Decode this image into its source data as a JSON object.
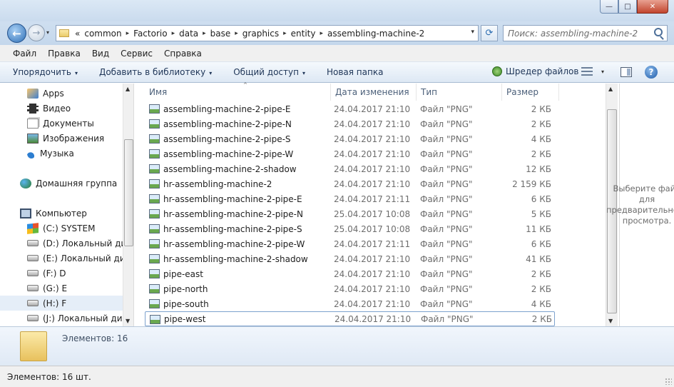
{
  "window": {
    "buttons": {
      "minimize": "—",
      "maximize": "□",
      "close": "✕"
    }
  },
  "navigation": {
    "back_glyph": "←",
    "forward_glyph": "→",
    "dropdown_glyph": "▾"
  },
  "address": {
    "overflow": "«",
    "crumbs": [
      "common",
      "Factorio",
      "data",
      "base",
      "graphics",
      "entity",
      "assembling-machine-2"
    ],
    "separator": "▸",
    "dropdown_glyph": "▾",
    "refresh_glyph": "⟳"
  },
  "search": {
    "placeholder": "Поиск: assembling-machine-2"
  },
  "menubar": [
    "Файл",
    "Правка",
    "Вид",
    "Сервис",
    "Справка"
  ],
  "commandbar": {
    "organize": "Упорядочить",
    "library": "Добавить в библиотеку",
    "share": "Общий доступ",
    "new_folder": "Новая папка",
    "shredder": "Шредер файлов",
    "help": "?",
    "arrow": "▾"
  },
  "nav": {
    "items": [
      {
        "label": "Apps",
        "icon": "apps-icon"
      },
      {
        "label": "Видео",
        "icon": "video-icon"
      },
      {
        "label": "Документы",
        "icon": "documents-icon"
      },
      {
        "label": "Изображения",
        "icon": "images-icon"
      },
      {
        "label": "Музыка",
        "icon": "music-icon"
      },
      {
        "label": "Домашняя группа",
        "icon": "homegroup-icon"
      },
      {
        "label": "Компьютер",
        "icon": "computer-icon"
      },
      {
        "label": "(C:) SYSTEM",
        "icon": "system-drive-icon"
      },
      {
        "label": "(D:) Локальный диск",
        "icon": "drive-icon"
      },
      {
        "label": "(E:) Локальный диск",
        "icon": "drive-icon"
      },
      {
        "label": "(F:) D",
        "icon": "drive-icon"
      },
      {
        "label": "(G:) E",
        "icon": "drive-icon"
      },
      {
        "label": "(H:) F",
        "icon": "drive-icon",
        "selected": true
      },
      {
        "label": "(J:) Локальный диск",
        "icon": "drive-icon"
      }
    ],
    "scroll_up": "▲",
    "scroll_down": "▼"
  },
  "columns": {
    "name": "Имя",
    "date": "Дата изменения",
    "type": "Тип",
    "size": "Размер",
    "sort_glyph": "^"
  },
  "files": [
    {
      "name": "assembling-machine-2-pipe-E",
      "date": "24.04.2017 21:10",
      "type": "Файл \"PNG\"",
      "size": "2 КБ"
    },
    {
      "name": "assembling-machine-2-pipe-N",
      "date": "24.04.2017 21:10",
      "type": "Файл \"PNG\"",
      "size": "2 КБ"
    },
    {
      "name": "assembling-machine-2-pipe-S",
      "date": "24.04.2017 21:10",
      "type": "Файл \"PNG\"",
      "size": "4 КБ"
    },
    {
      "name": "assembling-machine-2-pipe-W",
      "date": "24.04.2017 21:10",
      "type": "Файл \"PNG\"",
      "size": "2 КБ"
    },
    {
      "name": "assembling-machine-2-shadow",
      "date": "24.04.2017 21:10",
      "type": "Файл \"PNG\"",
      "size": "12 КБ"
    },
    {
      "name": "hr-assembling-machine-2",
      "date": "24.04.2017 21:10",
      "type": "Файл \"PNG\"",
      "size": "2 159 КБ"
    },
    {
      "name": "hr-assembling-machine-2-pipe-E",
      "date": "24.04.2017 21:11",
      "type": "Файл \"PNG\"",
      "size": "6 КБ"
    },
    {
      "name": "hr-assembling-machine-2-pipe-N",
      "date": "25.04.2017 10:08",
      "type": "Файл \"PNG\"",
      "size": "5 КБ"
    },
    {
      "name": "hr-assembling-machine-2-pipe-S",
      "date": "25.04.2017 10:08",
      "type": "Файл \"PNG\"",
      "size": "11 КБ"
    },
    {
      "name": "hr-assembling-machine-2-pipe-W",
      "date": "24.04.2017 21:11",
      "type": "Файл \"PNG\"",
      "size": "6 КБ"
    },
    {
      "name": "hr-assembling-machine-2-shadow",
      "date": "24.04.2017 21:10",
      "type": "Файл \"PNG\"",
      "size": "41 КБ"
    },
    {
      "name": "pipe-east",
      "date": "24.04.2017 21:10",
      "type": "Файл \"PNG\"",
      "size": "2 КБ"
    },
    {
      "name": "pipe-north",
      "date": "24.04.2017 21:10",
      "type": "Файл \"PNG\"",
      "size": "2 КБ"
    },
    {
      "name": "pipe-south",
      "date": "24.04.2017 21:10",
      "type": "Файл \"PNG\"",
      "size": "4 КБ"
    },
    {
      "name": "pipe-west",
      "date": "24.04.2017 21:10",
      "type": "Файл \"PNG\"",
      "size": "2 КБ",
      "focused": true
    }
  ],
  "preview": {
    "message": "Выберите файл для предварительного просмотра."
  },
  "details": {
    "count": "Элементов: 16"
  },
  "status": {
    "text": "Элементов: 16 шт."
  }
}
